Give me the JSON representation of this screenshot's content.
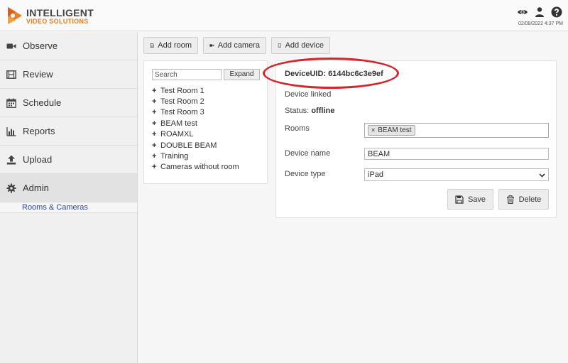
{
  "header": {
    "logo_line1": "INTELLIGENT",
    "logo_line2": "VIDEO SOLUTIONS",
    "icons": [
      "eye-icon",
      "user-icon",
      "help-icon"
    ],
    "datetime": "02/08/2022 4:37 PM"
  },
  "sidebar": {
    "items": [
      {
        "label": "Observe",
        "icon": "video-camera-icon"
      },
      {
        "label": "Review",
        "icon": "film-icon"
      },
      {
        "label": "Schedule",
        "icon": "calendar-icon"
      },
      {
        "label": "Reports",
        "icon": "bar-chart-icon"
      },
      {
        "label": "Upload",
        "icon": "upload-icon"
      },
      {
        "label": "Admin",
        "icon": "gear-icon",
        "active": true
      }
    ],
    "sub_items": [
      {
        "label": "Rooms & Cameras"
      }
    ]
  },
  "toolbar": {
    "add_room": "Add room",
    "add_camera": "Add camera",
    "add_device": "Add device"
  },
  "tree": {
    "search_placeholder": "Search",
    "expand_label": "Expand",
    "items": [
      "Test Room 1",
      "Test Room 2",
      "Test Room 3",
      "BEAM test",
      "ROAMXL",
      "DOUBLE BEAM",
      "Training",
      "Cameras without room"
    ]
  },
  "device": {
    "uid_text": "DeviceUID: 6144bc6c3e9ef",
    "linked_text": "Device linked",
    "status_label": "Status:",
    "status_value": "offline",
    "rooms_label": "Rooms",
    "room_tags": [
      "BEAM test"
    ],
    "name_label": "Device name",
    "name_value": "BEAM",
    "type_label": "Device type",
    "type_value": "iPad",
    "save_label": "Save",
    "delete_label": "Delete"
  },
  "colors": {
    "accent_orange": "#ef7d23",
    "link_blue": "#2a44b8",
    "highlight_red": "#d8232a"
  }
}
